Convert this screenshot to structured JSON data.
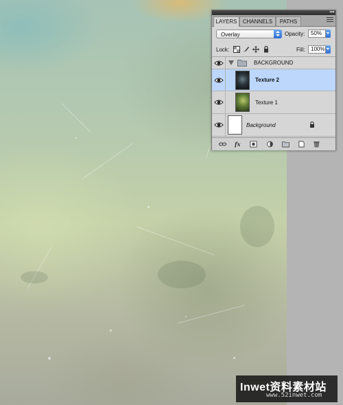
{
  "panel": {
    "tabs": [
      {
        "label": "LAYERS",
        "active": true
      },
      {
        "label": "CHANNELS",
        "active": false
      },
      {
        "label": "PATHS",
        "active": false
      }
    ],
    "blend_mode": "Overlay",
    "opacity_label": "Opacity:",
    "opacity_value": "50%",
    "lock_label": "Lock:",
    "fill_label": "Fill:",
    "fill_value": "100%",
    "layers": [
      {
        "name": "BACKGROUND",
        "kind": "group",
        "visible": true,
        "expanded": true
      },
      {
        "name": "Texture 2",
        "kind": "layer",
        "visible": true,
        "selected": true
      },
      {
        "name": "Texture 1",
        "kind": "layer",
        "visible": true,
        "selected": false
      },
      {
        "name": "Background",
        "kind": "background",
        "visible": true,
        "locked": true
      }
    ],
    "footer_icons": [
      "link-layers-icon",
      "fx-icon",
      "add-mask-icon",
      "adjustment-layer-icon",
      "new-group-icon",
      "new-layer-icon",
      "trash-icon"
    ]
  },
  "watermark": {
    "title": "Inwet资料素材站",
    "url": "www.52inwet.com"
  },
  "colors": {
    "selection": "#bcd7fb",
    "panel_bg": "#d6d6d6",
    "accent_blue": "#2f6fd1"
  }
}
